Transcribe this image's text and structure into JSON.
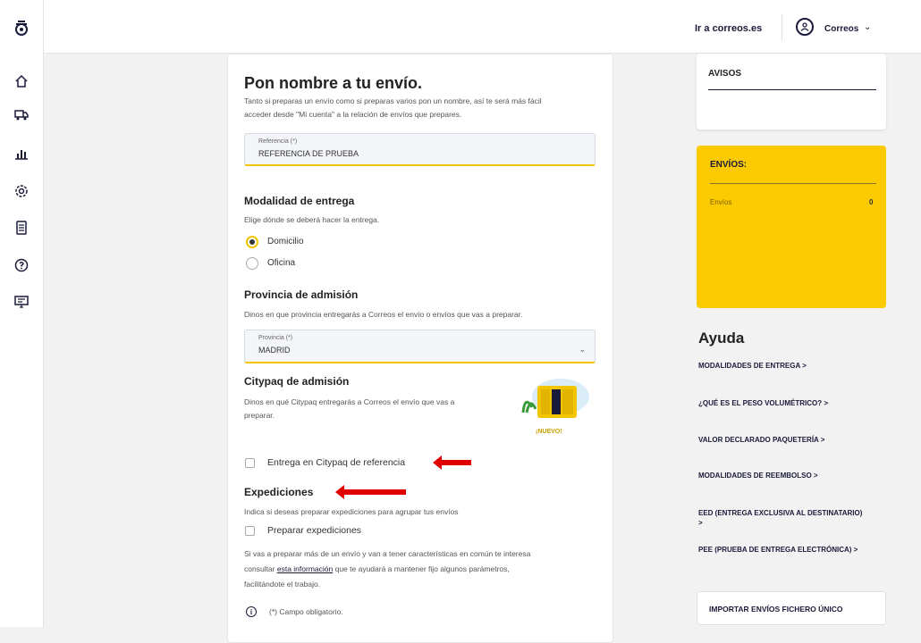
{
  "header": {
    "link": "Ir a correos.es",
    "user_label": "Correos"
  },
  "sidebar": {
    "icons": [
      "correos-logo",
      "home-icon",
      "truck-icon",
      "chart-icon",
      "settings-icon",
      "calculator-icon",
      "help-icon",
      "screen-icon"
    ]
  },
  "form": {
    "title": "Pon nombre a tu envío.",
    "intro_1": "Tanto si preparas un envío como si preparas varios pon un nombre, así te será más fácil",
    "intro_2": "acceder desde \"Mi cuenta\" a la relación de envíos que prepares.",
    "reference": {
      "label": "Referencia (*)",
      "value": "REFERENCIA DE PRUEBA"
    },
    "delivery": {
      "title": "Modalidad de entrega",
      "description": "Elige dónde se deberá hacer la entrega.",
      "options": [
        "Domicilio",
        "Oficina"
      ],
      "selected": "Domicilio"
    },
    "province": {
      "title": "Provincia de admisión",
      "description": "Dinos en que provincia entregarás a Correos el envío o envíos que vas a preparar.",
      "label": "Provincia (*)",
      "value": "MADRID"
    },
    "citypaq": {
      "title": "Citypaq de admisión",
      "description_1": "Dinos en qué Citypaq entregarás a Correos el envío que vas a",
      "description_2": "preparar.",
      "badge": "¡NUEVO!",
      "checkbox_label": "Entrega en Citypaq de referencia"
    },
    "expediciones": {
      "title": "Expediciones",
      "description": "Indica si deseas preparar expediciones para agrupar tus envíos",
      "checkbox_label": "Preparar expediciones",
      "info_1": "Si vas a preparar más de un envío y van a tener características en común te interesa",
      "info_2a": "consultar ",
      "info_link": "esta información",
      "info_2b": " que te ayudará a mantener fijo algunos parámetros,",
      "info_3": "facilitándote el trabajo."
    },
    "required_note": "(*) Campo obligatorio."
  },
  "avisos": {
    "title": "AVISOS"
  },
  "envios": {
    "title": "ENVÍOS:",
    "row_label": "Envíos",
    "row_value": "0"
  },
  "ayuda": {
    "title": "Ayuda",
    "links": [
      "MODALIDADES DE ENTREGA  >",
      "¿QUÉ ES EL PESO VOLUMÉTRICO?  >",
      "VALOR DECLARADO PAQUETERÍA  >",
      "MODALIDADES DE REEMBOLSO  >",
      "EED (ENTREGA EXCLUSIVA AL DESTINATARIO)  >",
      "PEE (PRUEBA DE ENTREGA ELECTRÓNICA)  >"
    ],
    "import_button": "IMPORTAR ENVÍOS FICHERO ÚNICO"
  },
  "colors": {
    "accent_yellow": "#fcca00",
    "navy": "#1a1a3a",
    "arrow_red": "#e00000"
  }
}
